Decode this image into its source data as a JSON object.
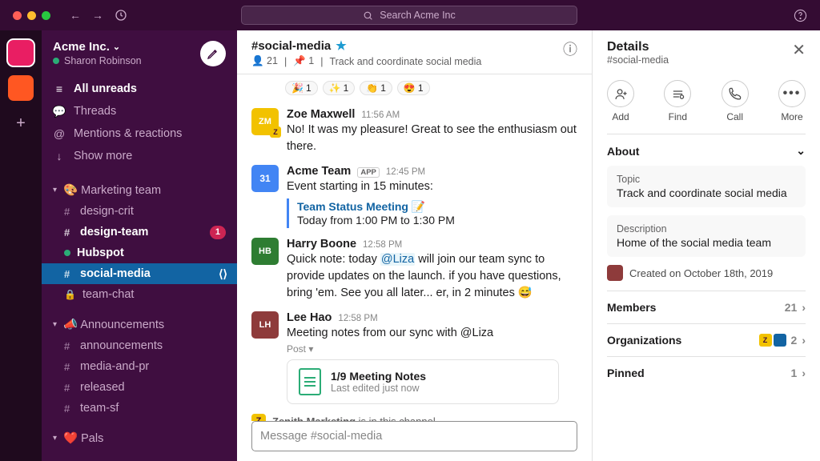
{
  "search": {
    "placeholder": "Search Acme Inc"
  },
  "workspace": {
    "name": "Acme Inc.",
    "user": "Sharon Robinson"
  },
  "sidebar": {
    "top": [
      {
        "icon": "≡",
        "label": "All unreads",
        "bold": true
      },
      {
        "icon": "💬",
        "label": "Threads"
      },
      {
        "icon": "@",
        "label": "Mentions & reactions"
      },
      {
        "icon": "↓",
        "label": "Show more"
      }
    ],
    "groups": [
      {
        "title": "🎨 Marketing team",
        "channels": [
          {
            "prefix": "#",
            "name": "design-crit"
          },
          {
            "prefix": "#",
            "name": "design-team",
            "bold": true,
            "badge": "1"
          },
          {
            "prefix": "dot",
            "name": "Hubspot",
            "bold": true
          },
          {
            "prefix": "#",
            "name": "social-media",
            "active": true,
            "arrows": true
          },
          {
            "prefix": "lock",
            "name": "team-chat"
          }
        ]
      },
      {
        "title": "📣 Announcements",
        "channels": [
          {
            "prefix": "#",
            "name": "announcements"
          },
          {
            "prefix": "#",
            "name": "media-and-pr"
          },
          {
            "prefix": "#",
            "name": "released"
          },
          {
            "prefix": "#",
            "name": "team-sf"
          }
        ]
      },
      {
        "title": "❤️ Pals",
        "channels": []
      }
    ]
  },
  "channel": {
    "name": "#social-media",
    "members": "21",
    "pins": "1",
    "topic": "Track and coordinate social media"
  },
  "reactions": [
    {
      "emoji": "🎉",
      "count": "1"
    },
    {
      "emoji": "✨",
      "count": "1"
    },
    {
      "emoji": "👏",
      "count": "1"
    },
    {
      "emoji": "😍",
      "count": "1"
    }
  ],
  "messages": {
    "zoe": {
      "name": "Zoe Maxwell",
      "time": "11:56 AM",
      "body": "No! It was my pleasure! Great to see the enthusiasm out there."
    },
    "cal": {
      "name": "Acme Team",
      "time": "12:45 PM",
      "body": "Event starting in 15 minutes:",
      "event_title": "Team Status Meeting 📝",
      "event_time": "Today from 1:00 PM to 1:30 PM"
    },
    "harry": {
      "name": "Harry Boone",
      "time": "12:58 PM",
      "pre": "Quick note: today ",
      "mention": "@Liza",
      "post": " will join our team sync to provide updates on the launch. if you have questions, bring 'em. See you all later... er, in 2 minutes 😅"
    },
    "lee": {
      "name": "Lee Hao",
      "time": "12:58 PM",
      "body": "Meeting notes from our sync with @Liza",
      "post_label": "Post ▾",
      "post_title": "1/9 Meeting Notes",
      "post_sub": "Last edited just now"
    }
  },
  "shared": {
    "org": "Zenith Marketing",
    "text": " is in this channel"
  },
  "composer": {
    "placeholder": "Message #social-media"
  },
  "details": {
    "title": "Details",
    "sub": "#social-media",
    "actions": [
      {
        "label": "Add"
      },
      {
        "label": "Find"
      },
      {
        "label": "Call"
      },
      {
        "label": "More"
      }
    ],
    "about_label": "About",
    "topic_label": "Topic",
    "topic": "Track and coordinate social media",
    "desc_label": "Description",
    "desc": "Home of the social media team",
    "created": "Created on October 18th, 2019",
    "members_label": "Members",
    "members_count": "21",
    "orgs_label": "Organizations",
    "orgs_count": "2",
    "pinned_label": "Pinned",
    "pinned_count": "1"
  }
}
